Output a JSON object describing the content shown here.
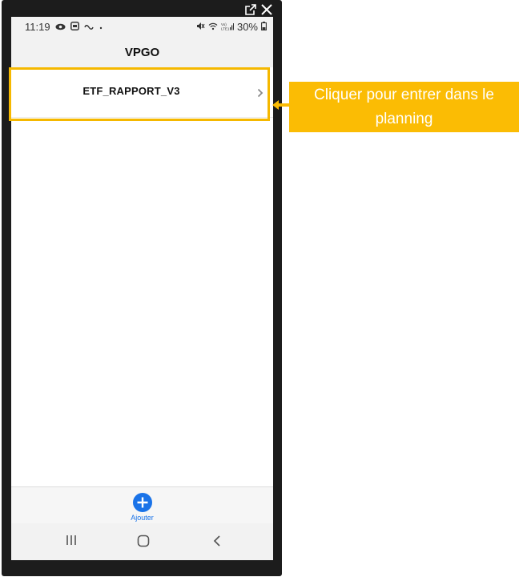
{
  "status_bar": {
    "time": "11:19",
    "battery": "30%",
    "signal_text": "Vo)\nLTE1"
  },
  "header": {
    "title": "VPGO"
  },
  "list": {
    "items": [
      {
        "label": "ETF_RAPPORT_V3"
      }
    ]
  },
  "bottom_bar": {
    "add_label": "Ajouter"
  },
  "callout": {
    "line1": "Cliquer pour entrer dans le",
    "line2": "planning"
  },
  "icons": {
    "window": [
      "open-external-icon",
      "close-icon"
    ],
    "status": [
      "eye-icon",
      "screen-record-icon",
      "link-icon",
      "mute-icon",
      "wifi-icon",
      "signal-icon",
      "battery-icon"
    ],
    "nav": [
      "recent-apps-icon",
      "home-icon",
      "back-icon"
    ]
  },
  "colors": {
    "highlight": "#f5b800",
    "callout_bg": "#fbbc04",
    "accent": "#1a73e8"
  }
}
